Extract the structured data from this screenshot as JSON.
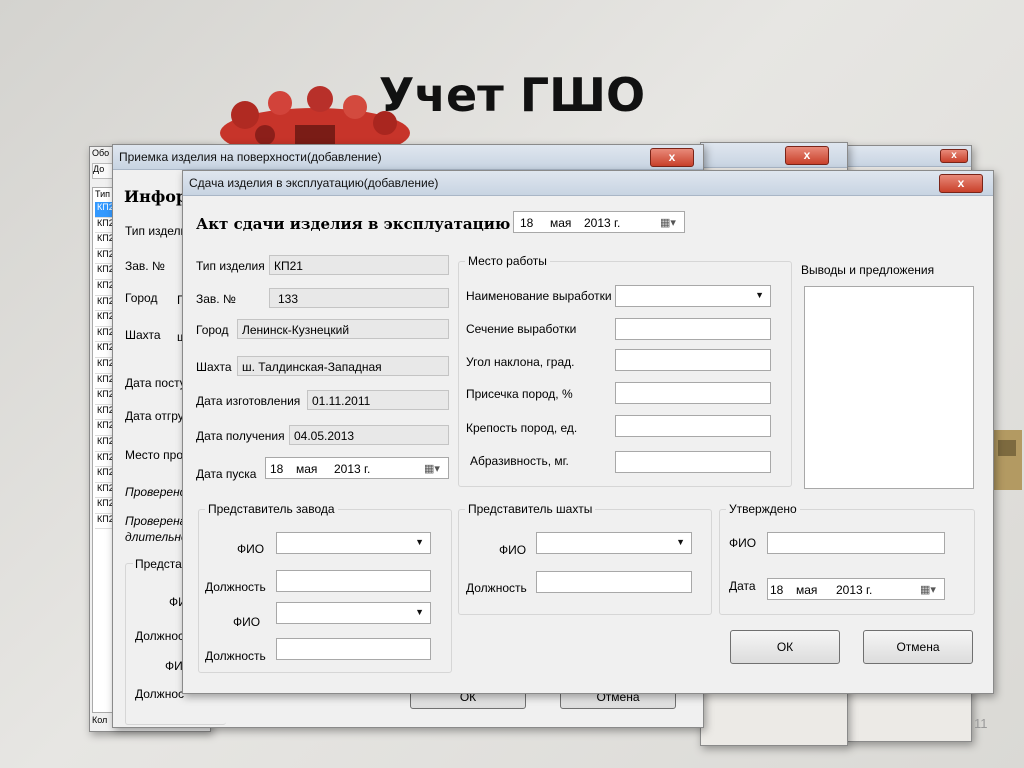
{
  "slide": {
    "title": "Учет ГШО",
    "page_number": "11"
  },
  "back_window": {
    "title": "Обо",
    "toolbar_label": "До",
    "list_header": "Тип",
    "list_items": [
      "КП21",
      "КП2",
      "КП2",
      "КП2",
      "КП2",
      "КП2",
      "КП2",
      "КП2",
      "КП2",
      "КП2",
      "КП2",
      "КП2",
      "КП2",
      "КП2",
      "КП2",
      "КП2",
      "КП2",
      "КП2",
      "КП2",
      "КП2",
      "КП2"
    ],
    "footer": "Кол"
  },
  "window_right_close": "x",
  "window_far_close": "x",
  "middle_window": {
    "title": "Приемка изделия на поверхности(добавление)",
    "close_label": "x",
    "heading": "Инфор",
    "labels": {
      "type": "Тип издели",
      "serial": "Зав. №",
      "city": "Город",
      "city_value": "Г",
      "mine": "Шахта",
      "mine_value": "ш",
      "received": "Дата посту",
      "shipped": "Дата отгру",
      "location": "Место пров",
      "checked1": "Проверено",
      "checked2": "Проверена",
      "checked2b": "длительно",
      "rep": "Предстае",
      "fio1": "ФИ",
      "pos1": "Должнос",
      "fio2": "ФИ",
      "pos2": "Должнос"
    },
    "btn_ok": "ОК",
    "btn_cancel": "Отмена"
  },
  "main_window": {
    "title": "Сдача изделия в эксплуатацию(добавление)",
    "close_label": "x",
    "heading": "Акт сдачи изделия в эксплуатацию от",
    "act_date": {
      "day": "18",
      "month": "мая",
      "year": "2013 г."
    },
    "product": {
      "type_label": "Тип изделия",
      "type_value": "КП21",
      "serial_label": "Зав. №",
      "serial_value": "133",
      "city_label": "Город",
      "city_value": "Ленинск-Кузнецкий",
      "mine_label": "Шахта",
      "mine_value": "ш. Талдинская-Западная",
      "made_label": "Дата изготовления",
      "made_value": "01.11.2011",
      "received_label": "Дата получения",
      "received_value": "04.05.2013",
      "start_label": "Дата пуска",
      "start_date": {
        "day": "18",
        "month": "мая",
        "year": "2013 г."
      }
    },
    "workplace": {
      "title": "Место работы",
      "name_label": "Наименование выработки",
      "section_label": "Сечение выработки",
      "angle_label": "Угол наклона, град.",
      "cut_label": "Присечка пород, %",
      "hardness_label": "Крепость пород, ед.",
      "abrasive_label": "Абразивность, мг."
    },
    "conclusions_label": "Выводы и предложения",
    "factory_rep": {
      "title": "Представитель завода",
      "fio_label": "ФИО",
      "position_label": "Должность",
      "fio2_label": "ФИО",
      "position2_label": "Должность"
    },
    "mine_rep": {
      "title": "Представитель шахты",
      "fio_label": "ФИО",
      "position_label": "Должность"
    },
    "approved": {
      "title": "Утверждено",
      "fio_label": "ФИО",
      "date_label": "Дата",
      "date": {
        "day": "18",
        "month": "мая",
        "year": "2013 г."
      }
    },
    "btn_ok": "ОК",
    "btn_cancel": "Отмена"
  }
}
